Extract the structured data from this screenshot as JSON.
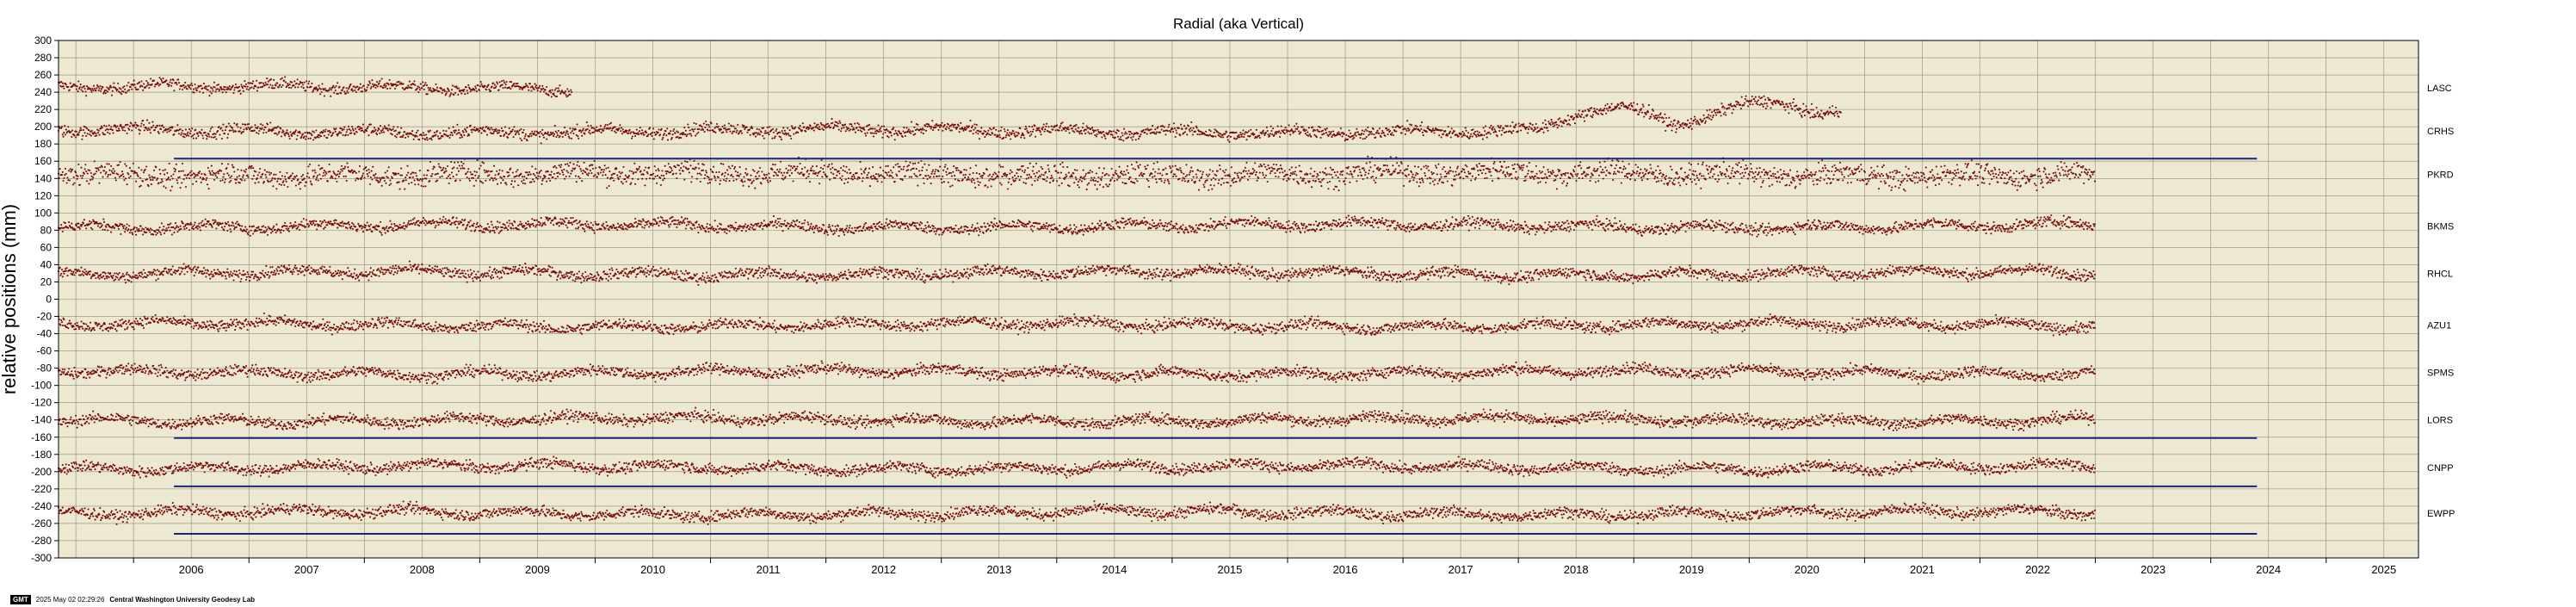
{
  "chart_data": {
    "type": "scatter",
    "title": "Radial (aka Vertical)",
    "ylabel": "relative positions (mm)",
    "xlabel": "",
    "xlim": [
      2005.35,
      2025.8
    ],
    "ylim": [
      -300,
      300
    ],
    "x_ticks": [
      "2006",
      "2007",
      "2008",
      "2009",
      "2010",
      "2011",
      "2012",
      "2013",
      "2014",
      "2015",
      "2016",
      "2017",
      "2018",
      "2019",
      "2020",
      "2021",
      "2022",
      "2023",
      "2024",
      "2025"
    ],
    "y_ticks": [
      300,
      280,
      260,
      240,
      220,
      200,
      180,
      160,
      140,
      120,
      100,
      80,
      60,
      40,
      20,
      0,
      -20,
      -40,
      -60,
      -80,
      -100,
      -120,
      -140,
      -160,
      -180,
      -200,
      -220,
      -240,
      -260,
      -280,
      -300
    ],
    "grid": true,
    "background_color": "#ece8d2",
    "point_color": "#7a0a0a",
    "line_color": "#1a237e",
    "series": [
      {
        "name": "LASC",
        "offset": 245,
        "start": 2005.35,
        "end": 2009.8,
        "noise": 4.5
      },
      {
        "name": "CRHS",
        "offset": 195,
        "start": 2005.35,
        "end": 2020.8,
        "noise": 5
      },
      {
        "name": "PKRD",
        "offset": 145,
        "start": 2005.35,
        "end": 2023.0,
        "noise": 9
      },
      {
        "name": "BKMS",
        "offset": 85,
        "start": 2005.35,
        "end": 2023.0,
        "noise": 4.5
      },
      {
        "name": "RHCL",
        "offset": 30,
        "start": 2005.35,
        "end": 2023.0,
        "noise": 4.5
      },
      {
        "name": "AZU1",
        "offset": -30,
        "start": 2005.35,
        "end": 2023.0,
        "noise": 4.5
      },
      {
        "name": "SPMS",
        "offset": -85,
        "start": 2005.35,
        "end": 2023.0,
        "noise": 4.5
      },
      {
        "name": "LORS",
        "offset": -140,
        "start": 2005.35,
        "end": 2023.0,
        "noise": 4.5
      },
      {
        "name": "CNPP",
        "offset": -195,
        "start": 2005.35,
        "end": 2023.0,
        "noise": 4.5
      },
      {
        "name": "EWPP",
        "offset": -248,
        "start": 2005.35,
        "end": 2023.0,
        "noise": 4.5
      }
    ],
    "reference_lines": [
      {
        "y": 163,
        "x_start": 2006.35,
        "x_end": 2024.4
      },
      {
        "y": -161,
        "x_start": 2006.35,
        "x_end": 2024.4
      },
      {
        "y": -217,
        "x_start": 2006.35,
        "x_end": 2024.4
      },
      {
        "y": -272,
        "x_start": 2006.35,
        "x_end": 2024.4
      }
    ]
  },
  "footer": {
    "badge": "GMT",
    "timestamp": "2025 May 02 02:29:26",
    "org": "Central Washington University Geodesy Lab"
  }
}
